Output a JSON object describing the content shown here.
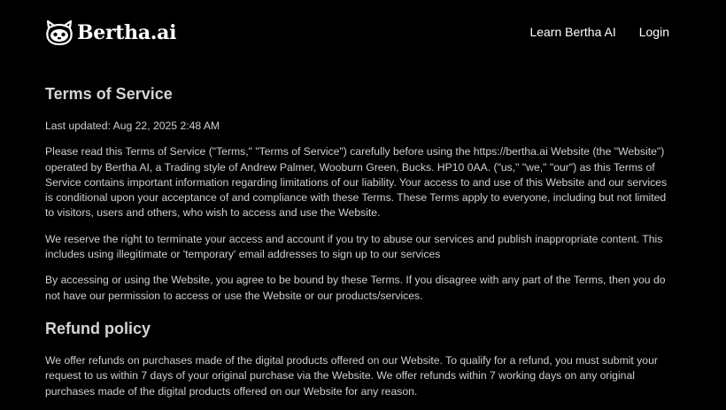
{
  "header": {
    "brand": "Bertha.ai",
    "nav": [
      "Learn Bertha AI",
      "Login"
    ]
  },
  "main": {
    "title": "Terms of Service",
    "last_updated": "Last updated: Aug 22, 2025 2:48 AM",
    "paragraphs": [
      "Please read this Terms of Service (\"Terms,\" \"Terms of Service\") carefully before using the https://bertha.ai Website (the \"Website\") operated by Bertha AI, a Trading style of Andrew Palmer, Wooburn Green, Bucks. HP10 0AA. (\"us,\" \"we,\" \"our\") as this Terms of Service contains important information regarding limitations of our liability. Your access to and use of this Website and our services is conditional upon your acceptance of and compliance with these Terms. These Terms apply to everyone, including but not limited to visitors, users and others, who wish to access and use the Website.",
      "We reserve the right to terminate your access and account if you try to abuse our services and publish inappropriate content. This includes using illegitimate or 'temporary' email addresses to sign up to our services",
      "By accessing or using the Website, you agree to be bound by these Terms. If you disagree with any part of the Terms, then you do not have our permission to access or use the Website or our products/services."
    ],
    "refund_heading": "Refund policy",
    "refund_paragraph": "We offer refunds on purchases made of the digital products offered on our Website. To qualify for a refund, you must submit your request to us within 7 days of your original purchase via the Website. We offer refunds within 7 working days on any original purchases made of the digital products offered on our Website for any reason."
  },
  "colors": {
    "background": "#000000",
    "text": "#cfcfcf",
    "heading": "#d4d4d4",
    "nav": "#ffffff"
  },
  "icons": {
    "logo": "bertha-robot-logo-icon"
  }
}
